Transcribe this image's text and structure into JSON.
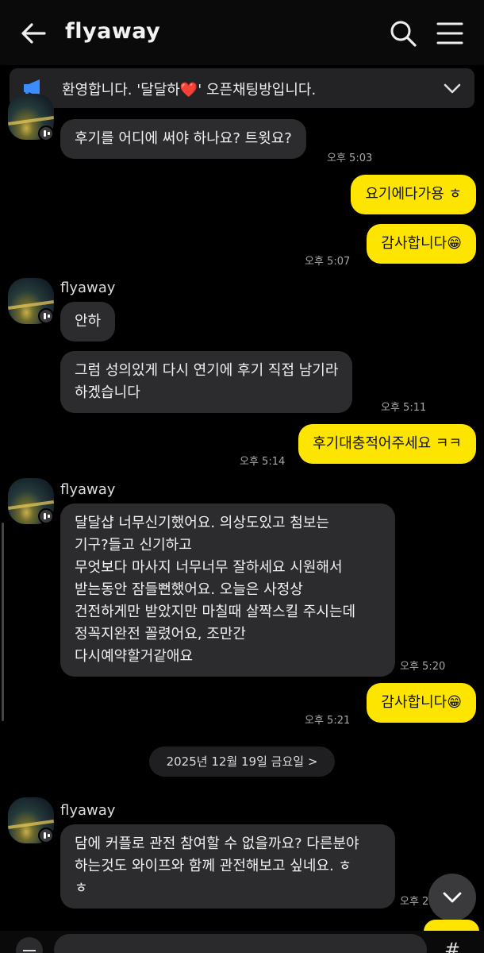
{
  "header": {
    "title": "flyaway"
  },
  "notice": {
    "text_before": "환영합니다. '달달하",
    "heart": "❤️",
    "text_after": "' 오픈채팅방입니다."
  },
  "messages": [
    {
      "text": "후기를 어디에 써야 하나요? 트윗요?",
      "time": "오후 5:03"
    },
    {
      "text": "요기에다가용 ㅎ"
    },
    {
      "text": "감사합니다😁",
      "time": "오후 5:07"
    },
    {
      "sender": "flyaway",
      "text": "안하"
    },
    {
      "text": "그럼 성의있게 다시 연기에 후기 직접 남기라\n하겠습니다",
      "time": "오후 5:11"
    },
    {
      "text": "후기대충적어주세요 ㅋㅋ",
      "time": "오후 5:14"
    },
    {
      "sender": "flyaway",
      "text": "달달샵 너무신기했어요. 의상도있고 첨보는\n기구?들고 신기하고\n무엇보다 마사지 너무너무 잘하세요 시원해서\n받는동안 잠들뻔했어요. 오늘은 사정상\n건전하게만 받았지만 마칠때 살짝스킬 주시는데\n정꼭지완전 꼴렸어요, 조만간\n다시예약할거같애요",
      "time": "오후 5:20"
    },
    {
      "text": "감사합니다😁",
      "time": "오후 5:21"
    },
    {
      "sender": "flyaway",
      "text": "담에 커플로 관전 참여할 수 없을까요? 다른분야\n하는것도 와이프와 함께 관전해보고 싶네요. ㅎ\nㅎ",
      "time": "오후 2:"
    }
  ],
  "date_divider": "2025년 12월 19일 금요일 >",
  "colors": {
    "my_bubble": "#fee500",
    "their_bubble": "#2c2c2e",
    "background": "#000000"
  }
}
